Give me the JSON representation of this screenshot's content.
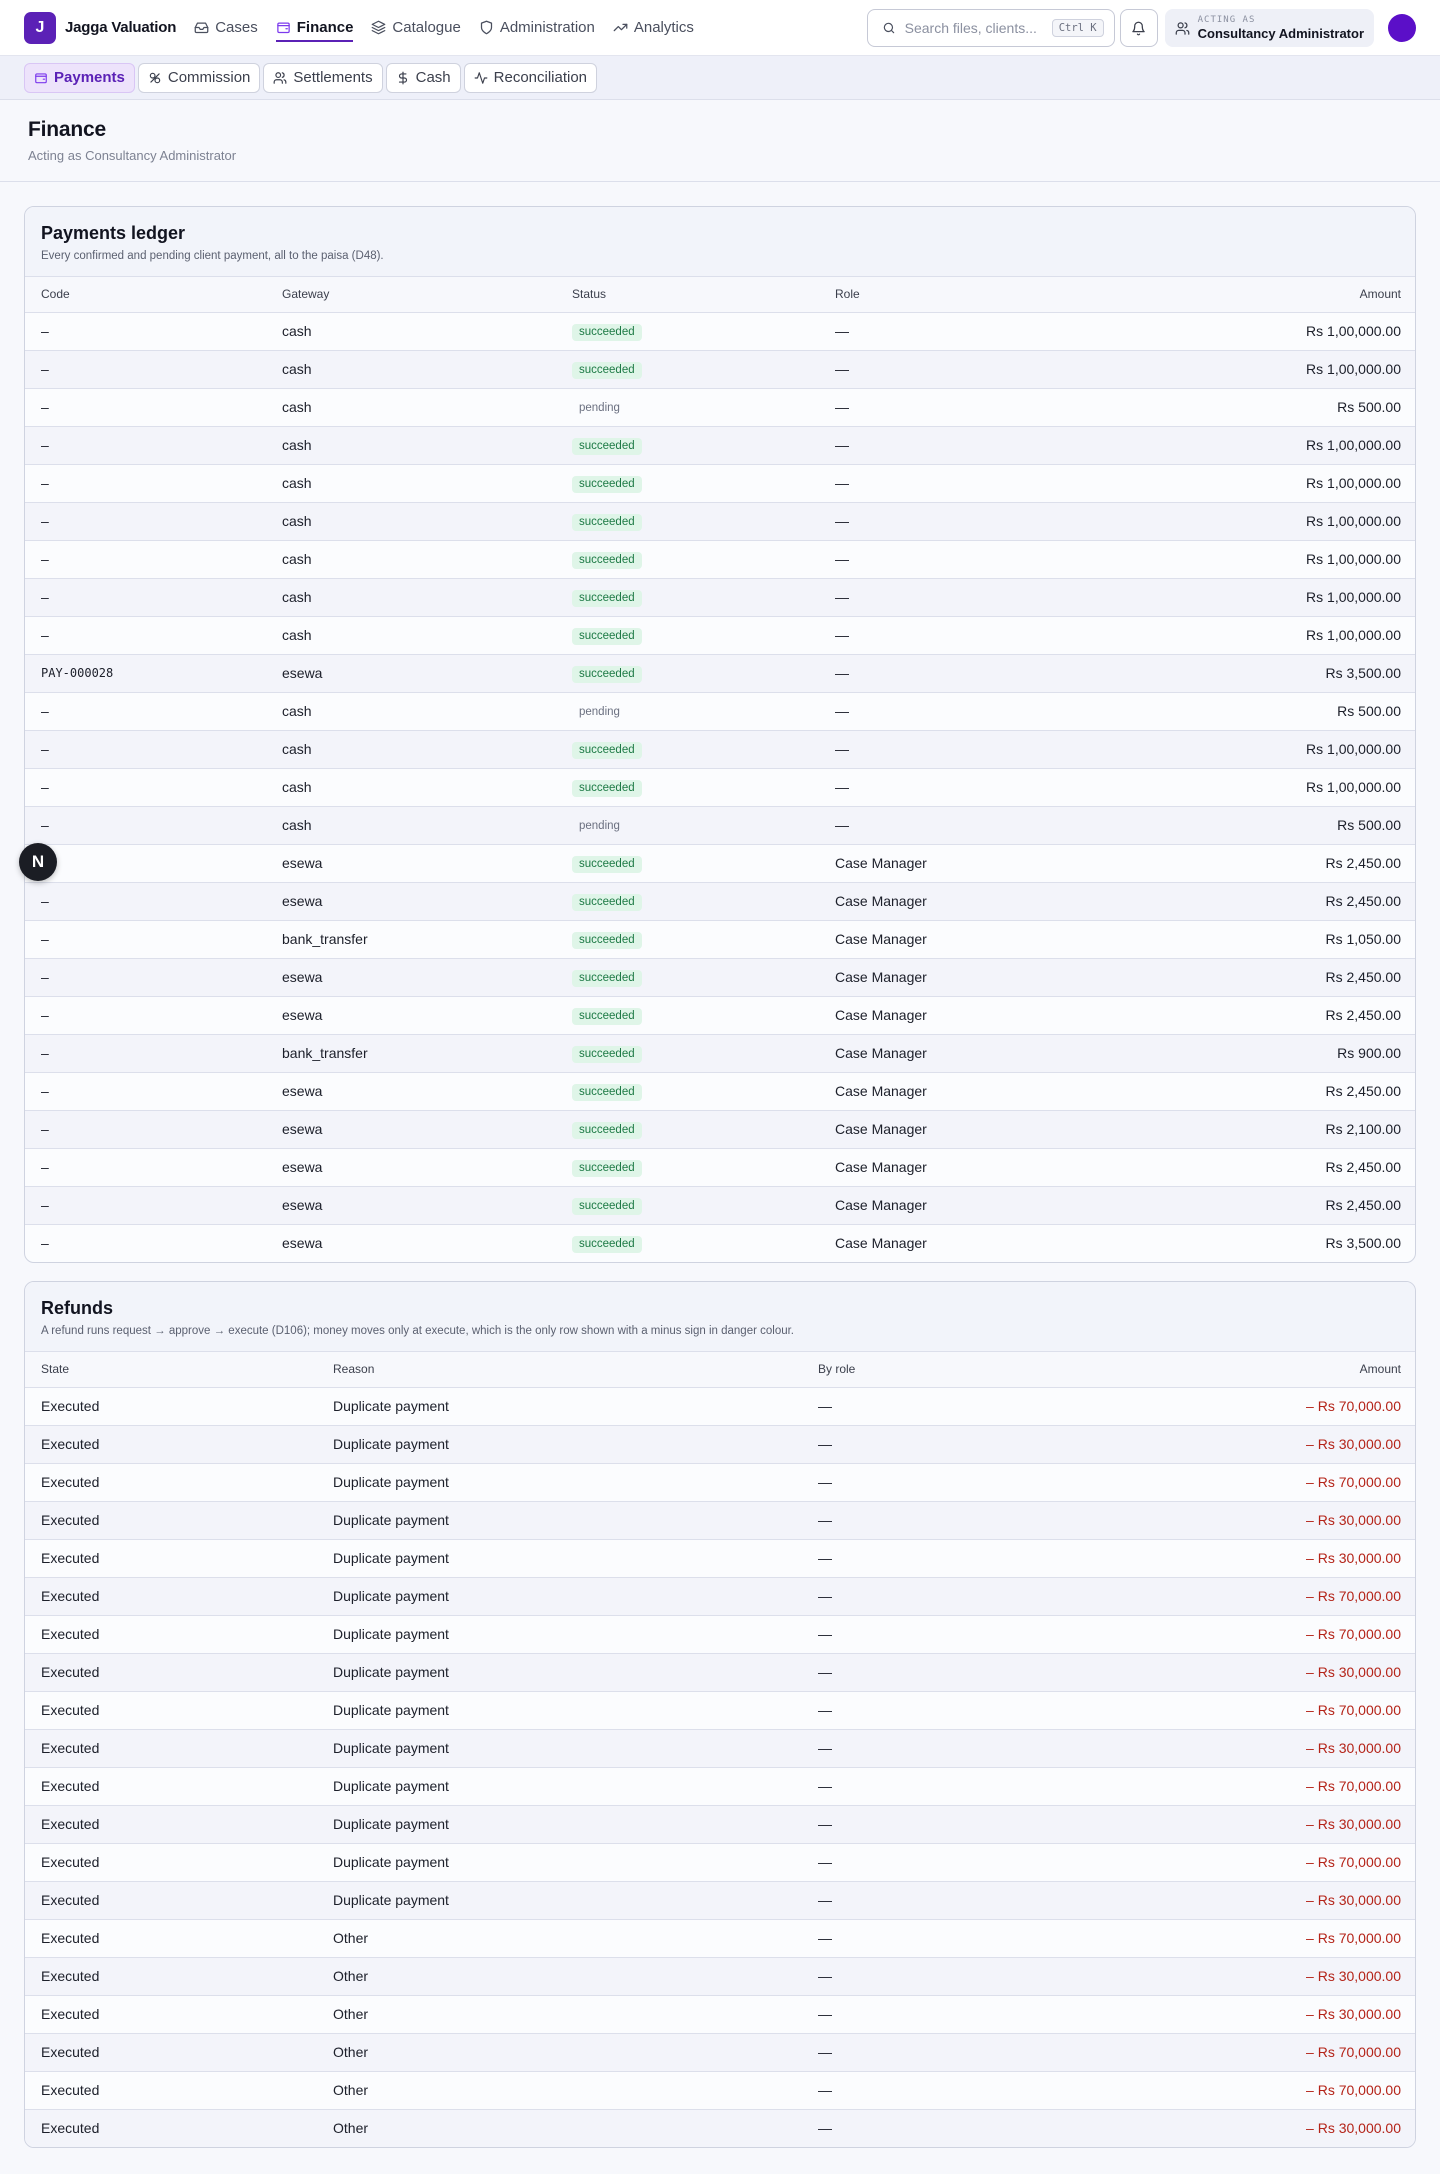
{
  "brand": {
    "initial": "J",
    "name": "Jagga Valuation"
  },
  "nav": [
    {
      "label": "Cases",
      "icon": "inbox-icon"
    },
    {
      "label": "Finance",
      "icon": "wallet-icon",
      "active": true
    },
    {
      "label": "Catalogue",
      "icon": "layers-icon"
    },
    {
      "label": "Administration",
      "icon": "shield-icon"
    },
    {
      "label": "Analytics",
      "icon": "trending-up-icon"
    }
  ],
  "search": {
    "placeholder": "Search files, clients...",
    "shortcut": "Ctrl K"
  },
  "acting": {
    "label": "ACTING AS",
    "name": "Consultancy Administrator"
  },
  "subtabs": [
    {
      "label": "Payments",
      "icon": "wallet-icon",
      "active": true
    },
    {
      "label": "Commission",
      "icon": "percent-icon"
    },
    {
      "label": "Settlements",
      "icon": "users-icon"
    },
    {
      "label": "Cash",
      "icon": "dollar-icon"
    },
    {
      "label": "Reconciliation",
      "icon": "activity-icon"
    }
  ],
  "page": {
    "title": "Finance",
    "subtitle": "Acting as Consultancy Administrator"
  },
  "payments": {
    "title": "Payments ledger",
    "description": "Every confirmed and pending client payment, all to the paisa (D48).",
    "columns": [
      "Code",
      "Gateway",
      "Status",
      "Role",
      "Amount"
    ],
    "rows": [
      {
        "code": "–",
        "gateway": "cash",
        "status": "succeeded",
        "role": "—",
        "amount": "Rs 1,00,000.00"
      },
      {
        "code": "–",
        "gateway": "cash",
        "status": "succeeded",
        "role": "—",
        "amount": "Rs 1,00,000.00"
      },
      {
        "code": "–",
        "gateway": "cash",
        "status": "pending",
        "role": "—",
        "amount": "Rs 500.00"
      },
      {
        "code": "–",
        "gateway": "cash",
        "status": "succeeded",
        "role": "—",
        "amount": "Rs 1,00,000.00"
      },
      {
        "code": "–",
        "gateway": "cash",
        "status": "succeeded",
        "role": "—",
        "amount": "Rs 1,00,000.00"
      },
      {
        "code": "–",
        "gateway": "cash",
        "status": "succeeded",
        "role": "—",
        "amount": "Rs 1,00,000.00"
      },
      {
        "code": "–",
        "gateway": "cash",
        "status": "succeeded",
        "role": "—",
        "amount": "Rs 1,00,000.00"
      },
      {
        "code": "–",
        "gateway": "cash",
        "status": "succeeded",
        "role": "—",
        "amount": "Rs 1,00,000.00"
      },
      {
        "code": "–",
        "gateway": "cash",
        "status": "succeeded",
        "role": "—",
        "amount": "Rs 1,00,000.00"
      },
      {
        "code": "PAY-000028",
        "gateway": "esewa",
        "status": "succeeded",
        "role": "—",
        "amount": "Rs 3,500.00"
      },
      {
        "code": "–",
        "gateway": "cash",
        "status": "pending",
        "role": "—",
        "amount": "Rs 500.00"
      },
      {
        "code": "–",
        "gateway": "cash",
        "status": "succeeded",
        "role": "—",
        "amount": "Rs 1,00,000.00"
      },
      {
        "code": "–",
        "gateway": "cash",
        "status": "succeeded",
        "role": "—",
        "amount": "Rs 1,00,000.00"
      },
      {
        "code": "–",
        "gateway": "cash",
        "status": "pending",
        "role": "—",
        "amount": "Rs 500.00"
      },
      {
        "code": "–",
        "gateway": "esewa",
        "status": "succeeded",
        "role": "Case Manager",
        "amount": "Rs 2,450.00"
      },
      {
        "code": "–",
        "gateway": "esewa",
        "status": "succeeded",
        "role": "Case Manager",
        "amount": "Rs 2,450.00"
      },
      {
        "code": "–",
        "gateway": "bank_transfer",
        "status": "succeeded",
        "role": "Case Manager",
        "amount": "Rs 1,050.00"
      },
      {
        "code": "–",
        "gateway": "esewa",
        "status": "succeeded",
        "role": "Case Manager",
        "amount": "Rs 2,450.00"
      },
      {
        "code": "–",
        "gateway": "esewa",
        "status": "succeeded",
        "role": "Case Manager",
        "amount": "Rs 2,450.00"
      },
      {
        "code": "–",
        "gateway": "bank_transfer",
        "status": "succeeded",
        "role": "Case Manager",
        "amount": "Rs 900.00"
      },
      {
        "code": "–",
        "gateway": "esewa",
        "status": "succeeded",
        "role": "Case Manager",
        "amount": "Rs 2,450.00"
      },
      {
        "code": "–",
        "gateway": "esewa",
        "status": "succeeded",
        "role": "Case Manager",
        "amount": "Rs 2,100.00"
      },
      {
        "code": "–",
        "gateway": "esewa",
        "status": "succeeded",
        "role": "Case Manager",
        "amount": "Rs 2,450.00"
      },
      {
        "code": "–",
        "gateway": "esewa",
        "status": "succeeded",
        "role": "Case Manager",
        "amount": "Rs 2,450.00"
      },
      {
        "code": "–",
        "gateway": "esewa",
        "status": "succeeded",
        "role": "Case Manager",
        "amount": "Rs 3,500.00"
      }
    ]
  },
  "refunds": {
    "title": "Refunds",
    "description": "A refund runs request → approve → execute (D106); money moves only at execute, which is the only row shown with a minus sign in danger colour.",
    "columns": [
      "State",
      "Reason",
      "By role",
      "Amount"
    ],
    "rows": [
      {
        "state": "Executed",
        "reason": "Duplicate payment",
        "by_role": "—",
        "amount": "– Rs 70,000.00"
      },
      {
        "state": "Executed",
        "reason": "Duplicate payment",
        "by_role": "—",
        "amount": "– Rs 30,000.00"
      },
      {
        "state": "Executed",
        "reason": "Duplicate payment",
        "by_role": "—",
        "amount": "– Rs 70,000.00"
      },
      {
        "state": "Executed",
        "reason": "Duplicate payment",
        "by_role": "—",
        "amount": "– Rs 30,000.00"
      },
      {
        "state": "Executed",
        "reason": "Duplicate payment",
        "by_role": "—",
        "amount": "– Rs 30,000.00"
      },
      {
        "state": "Executed",
        "reason": "Duplicate payment",
        "by_role": "—",
        "amount": "– Rs 70,000.00"
      },
      {
        "state": "Executed",
        "reason": "Duplicate payment",
        "by_role": "—",
        "amount": "– Rs 70,000.00"
      },
      {
        "state": "Executed",
        "reason": "Duplicate payment",
        "by_role": "—",
        "amount": "– Rs 30,000.00"
      },
      {
        "state": "Executed",
        "reason": "Duplicate payment",
        "by_role": "—",
        "amount": "– Rs 70,000.00"
      },
      {
        "state": "Executed",
        "reason": "Duplicate payment",
        "by_role": "—",
        "amount": "– Rs 30,000.00"
      },
      {
        "state": "Executed",
        "reason": "Duplicate payment",
        "by_role": "—",
        "amount": "– Rs 70,000.00"
      },
      {
        "state": "Executed",
        "reason": "Duplicate payment",
        "by_role": "—",
        "amount": "– Rs 30,000.00"
      },
      {
        "state": "Executed",
        "reason": "Duplicate payment",
        "by_role": "—",
        "amount": "– Rs 70,000.00"
      },
      {
        "state": "Executed",
        "reason": "Duplicate payment",
        "by_role": "—",
        "amount": "– Rs 30,000.00"
      },
      {
        "state": "Executed",
        "reason": "Other",
        "by_role": "—",
        "amount": "– Rs 70,000.00"
      },
      {
        "state": "Executed",
        "reason": "Other",
        "by_role": "—",
        "amount": "– Rs 30,000.00"
      },
      {
        "state": "Executed",
        "reason": "Other",
        "by_role": "—",
        "amount": "– Rs 30,000.00"
      },
      {
        "state": "Executed",
        "reason": "Other",
        "by_role": "—",
        "amount": "– Rs 70,000.00"
      },
      {
        "state": "Executed",
        "reason": "Other",
        "by_role": "—",
        "amount": "– Rs 70,000.00"
      },
      {
        "state": "Executed",
        "reason": "Other",
        "by_role": "—",
        "amount": "– Rs 30,000.00"
      }
    ]
  },
  "dev_badge": {
    "letter": "N"
  },
  "colors": {
    "accent": "#5b21b6",
    "success_bg": "#dff5e8",
    "success_fg": "#1d7a45",
    "danger": "#b42318"
  }
}
